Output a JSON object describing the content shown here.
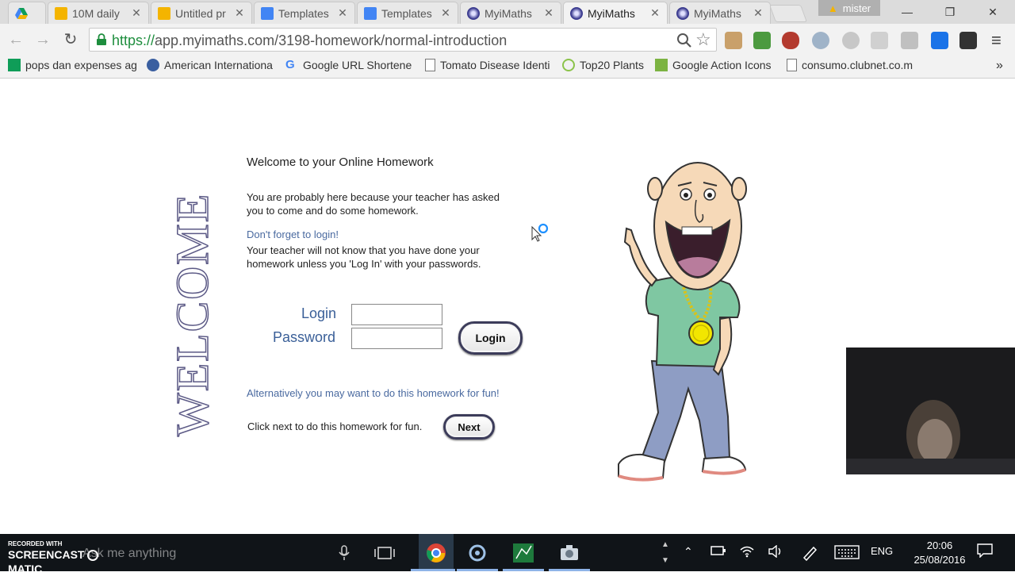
{
  "browser": {
    "tabs": [
      {
        "label": "",
        "icon": "google-drive-icon",
        "active": false
      },
      {
        "label": "10M daily",
        "icon": "slides-icon",
        "active": false
      },
      {
        "label": "Untitled pr",
        "icon": "slides-icon",
        "active": false
      },
      {
        "label": "Templates",
        "icon": "docs-icon",
        "active": false
      },
      {
        "label": "Templates",
        "icon": "docs-icon",
        "active": false
      },
      {
        "label": "MyiMaths",
        "icon": "myimaths-icon",
        "active": false
      },
      {
        "label": "MyiMaths",
        "icon": "myimaths-icon",
        "active": true
      },
      {
        "label": "MyiMaths",
        "icon": "myimaths-icon",
        "active": false
      }
    ],
    "profile_name": "mister",
    "url_scheme": "https://",
    "url_rest": "app.myimaths.com/3198-homework/normal-introduction",
    "bookmarks": [
      {
        "label": "pops dan expenses ag",
        "icon": "sheets-icon"
      },
      {
        "label": "American Internationa",
        "icon": "globe-icon"
      },
      {
        "label": "Google URL Shortene",
        "icon": "google-icon"
      },
      {
        "label": "Tomato Disease Identi",
        "icon": "page-icon"
      },
      {
        "label": "Top20 Plants",
        "icon": "leaf-icon"
      },
      {
        "label": "Google Action Icons",
        "icon": "image-icon"
      },
      {
        "label": "consumo.clubnet.co.m",
        "icon": "page-icon"
      }
    ],
    "more_bookmarks": "»"
  },
  "page": {
    "welcome_vertical": "WELCOME",
    "title": "Welcome to your Online Homework",
    "intro": "You are probably here because your teacher has asked you to come and do some homework.",
    "reminder": "Don't forget to login!",
    "reminder_detail": "Your teacher will not know that you have done your homework unless you 'Log In' with your passwords.",
    "login_label": "Login",
    "password_label": "Password",
    "login_value": "",
    "password_value": "",
    "login_button": "Login",
    "alternative": "Alternatively you may want to do this homework for fun!",
    "click_next": "Click next to do this homework for fun.",
    "next_button": "Next"
  },
  "taskbar": {
    "recorded_with": "RECORDED WITH",
    "screencast_brand": "SCREENCAST",
    "screencast_brand2": "MATIC",
    "search_placeholder": "Ask me anything",
    "language": "ENG",
    "time": "20:06",
    "date": "25/08/2016"
  },
  "colors": {
    "link_blue": "#4a6aa0",
    "label_blue": "#3a5f98",
    "welcome_stroke": "#5c5a86",
    "https_green": "#1e8e3e"
  }
}
